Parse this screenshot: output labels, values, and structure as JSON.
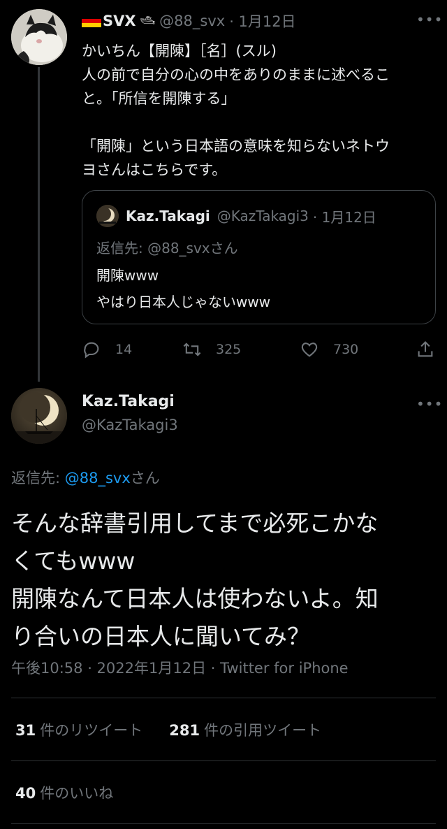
{
  "parent_tweet": {
    "display_name": "SVX",
    "flag": "germany-flag",
    "emoji": "🛥",
    "handle": "@88_svx",
    "time": "· 1月12日",
    "lines": [
      "かいちん【開陳】［名］(スル)",
      "人の前で自分の心の中をありのままに述べるこ",
      "と。「所信を開陳する」",
      "",
      "「開陳」という日本語の意味を知らないネトウ",
      "ヨさんはこちらです。"
    ],
    "quote": {
      "display_name": "Kaz.Takagi",
      "handle": "@KazTakagi3",
      "time": "· 1月12日",
      "reply_to": "返信先: @88_svxさん",
      "lines": [
        "開陳www",
        "やはり日本人じゃないwww"
      ]
    },
    "actions": {
      "reply_count": "14",
      "retweet_count": "325",
      "like_count": "730"
    }
  },
  "main_tweet": {
    "display_name": "Kaz.Takagi",
    "handle": "@KazTakagi3",
    "reply_prefix": "返信先: ",
    "reply_handle": "@88_svx",
    "reply_suffix": "さん",
    "lines": [
      "そんな辞書引用してまで必死こかな",
      "くてもwww",
      "開陳なんて日本人は使わないよ。知",
      "り合いの日本人に聞いてみ？"
    ],
    "meta": "午後10:58 · 2022年1月12日 · Twitter for iPhone",
    "stats": {
      "retweets": "31",
      "retweets_label": "件のリツイート",
      "quotes": "281",
      "quotes_label": "件の引用ツイート",
      "likes": "40",
      "likes_label": "件のいいね"
    }
  },
  "colors": {
    "background": "#000000",
    "text": "#e7e9ea",
    "muted": "#71767b",
    "link": "#1d9bf0",
    "divider": "#2f3336"
  }
}
